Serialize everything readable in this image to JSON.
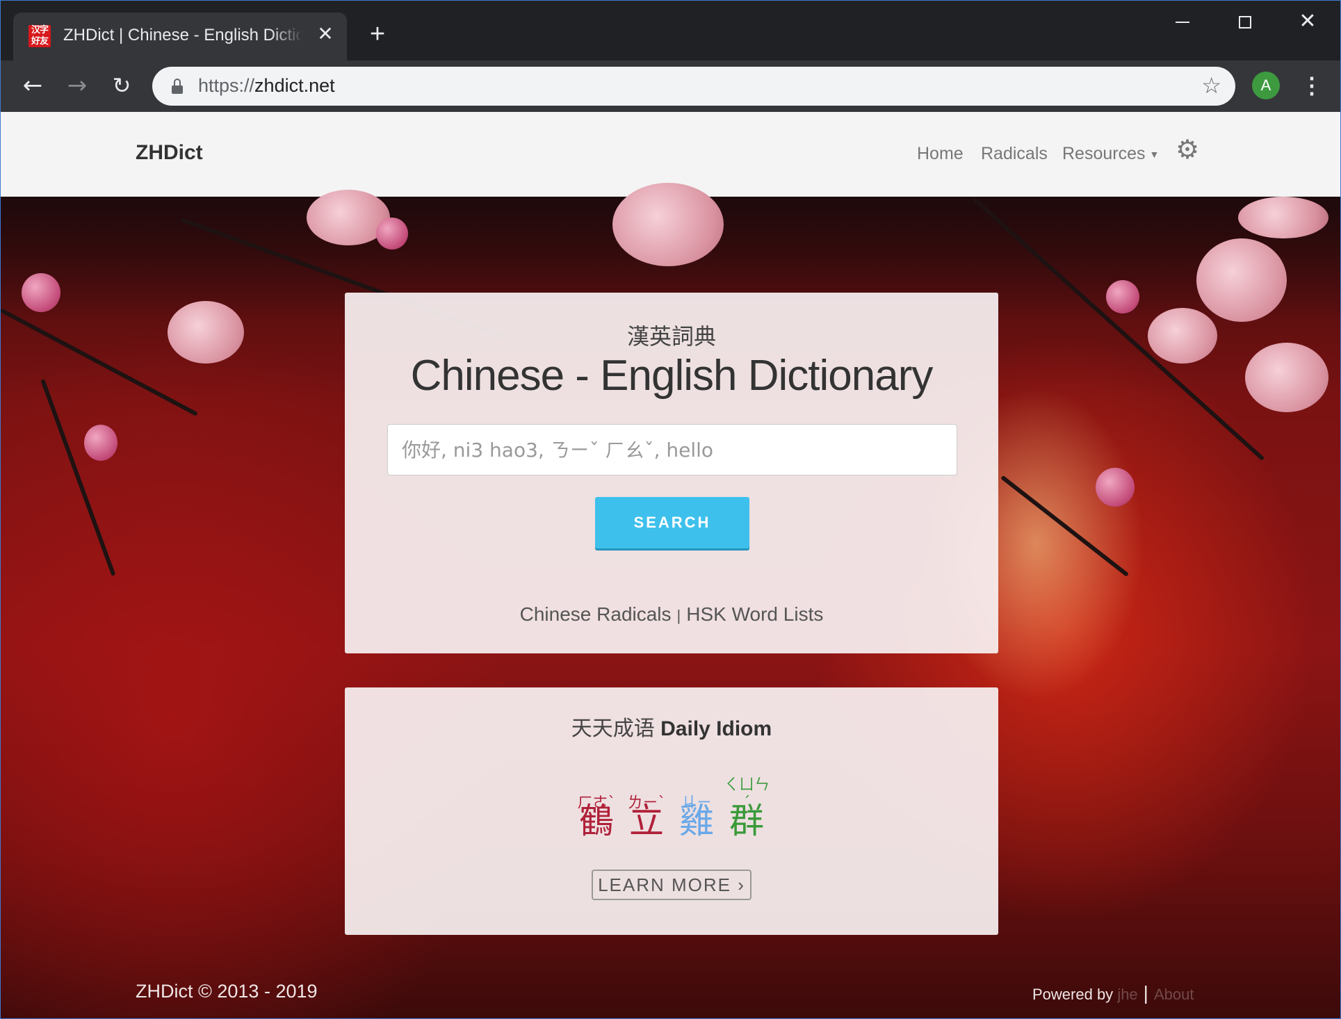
{
  "browser": {
    "tab_title": "ZHDict | Chinese - English Dictionary",
    "tab_favicon_text": "汉字好友",
    "url_scheme": "https://",
    "url_host": "zhdict.net",
    "profile_initial": "A"
  },
  "navbar": {
    "brand": "ZHDict",
    "links": [
      "Home",
      "Radicals",
      "Resources"
    ]
  },
  "search_card": {
    "title_zh": "漢英詞典",
    "title_en": "Chinese - English Dictionary",
    "placeholder": "你好, ni3 hao3, ㄋㄧˇ ㄏㄠˇ, hello",
    "search_label": "SEARCH",
    "link_radicals": "Chinese Radicals",
    "link_separator": "|",
    "link_hsk": "HSK Word Lists"
  },
  "idiom_card": {
    "title_zh": "天天成语",
    "title_en": "Daily Idiom",
    "characters": [
      {
        "bopomofo": "ㄏㄜˋ",
        "char": "鶴",
        "color": "#b0213a"
      },
      {
        "bopomofo": "ㄌㄧˋ",
        "char": "立",
        "color": "#b0213a"
      },
      {
        "bopomofo": "ㄐㄧ",
        "char": "雞",
        "color": "#6aa8e8"
      },
      {
        "bopomofo": "ㄑㄩㄣˊ",
        "char": "群",
        "color": "#3a9a3a"
      }
    ],
    "learn_more_label": "LEARN MORE ›"
  },
  "footer": {
    "copyright": "ZHDict © 2013 - 2019",
    "powered_by": "Powered by",
    "powered_name": "jhe",
    "separator": "|",
    "about": "About"
  }
}
